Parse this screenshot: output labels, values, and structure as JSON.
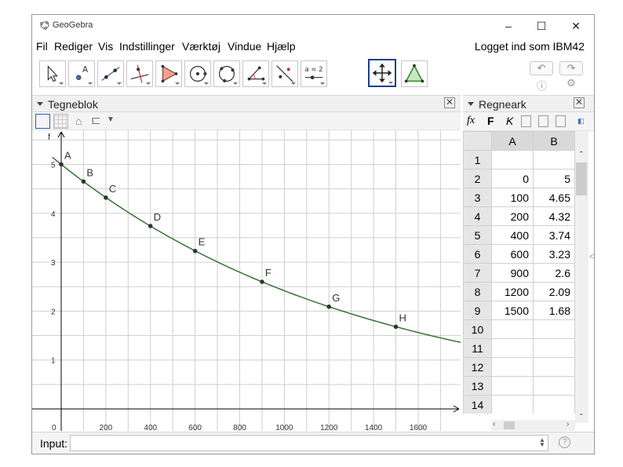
{
  "window": {
    "title": "GeoGebra",
    "controls": {
      "minimize": "–",
      "maximize": "☐",
      "close": "✕"
    }
  },
  "menubar": {
    "items": [
      "Fil",
      "Rediger",
      "Vis",
      "Indstillinger",
      "Værktøj",
      "Vindue",
      "Hjælp"
    ],
    "login": "Logget ind som IBM42"
  },
  "toolbar": {
    "tools": [
      {
        "icon": "move-arrow-icon",
        "active": false
      },
      {
        "icon": "point-icon",
        "active": false,
        "label": "A"
      },
      {
        "icon": "line-icon",
        "active": false
      },
      {
        "icon": "perpendicular-line-icon",
        "active": false
      },
      {
        "icon": "polygon-icon",
        "active": false
      },
      {
        "icon": "circle-center-point-icon",
        "active": false
      },
      {
        "icon": "circle-three-points-icon",
        "active": false
      },
      {
        "icon": "angle-icon",
        "active": false
      },
      {
        "icon": "reflect-icon",
        "active": false
      },
      {
        "icon": "slider-icon",
        "active": false,
        "label": "a = 2"
      },
      {
        "icon": "move-graphics-view-icon",
        "active": true
      },
      {
        "icon": "triangle-icon",
        "active": false
      }
    ],
    "undo": "↶",
    "redo": "↷"
  },
  "graphics": {
    "panel_title": "Tegneblok",
    "function_label": "f",
    "x_ticks": [
      {
        "value": 0,
        "label": "0"
      },
      {
        "value": 200,
        "label": "200"
      },
      {
        "value": 400,
        "label": "400"
      },
      {
        "value": 600,
        "label": "600"
      },
      {
        "value": 800,
        "label": "800"
      },
      {
        "value": 1000,
        "label": "1000"
      },
      {
        "value": 1200,
        "label": "1200"
      },
      {
        "value": 1400,
        "label": "1400"
      },
      {
        "value": 1600,
        "label": "1600"
      }
    ],
    "y_ticks": [
      {
        "value": 1,
        "label": "1"
      },
      {
        "value": 2,
        "label": "2"
      },
      {
        "value": 3,
        "label": "3"
      },
      {
        "value": 4,
        "label": "4"
      },
      {
        "value": 5,
        "label": "5"
      }
    ],
    "points": [
      {
        "name": "A",
        "x": 0,
        "y": 5
      },
      {
        "name": "B",
        "x": 100,
        "y": 4.65
      },
      {
        "name": "C",
        "x": 200,
        "y": 4.32
      },
      {
        "name": "D",
        "x": 400,
        "y": 3.74
      },
      {
        "name": "E",
        "x": 600,
        "y": 3.23
      },
      {
        "name": "F",
        "x": 900,
        "y": 2.6
      },
      {
        "name": "G",
        "x": 1200,
        "y": 2.09
      },
      {
        "name": "H",
        "x": 1500,
        "y": 1.68
      }
    ],
    "curve": {
      "a": 5,
      "k": 0.000727,
      "color": "#2a6b2a"
    },
    "axis_range": {
      "x": [
        -20,
        1790
      ],
      "y": [
        -0.1,
        5.3
      ]
    }
  },
  "spreadsheet": {
    "panel_title": "Regneark",
    "format_buttons": {
      "fx": "fx",
      "bold": "F",
      "italic": "K"
    },
    "columns": [
      "A",
      "B"
    ],
    "rows": [
      {
        "n": "1",
        "a": "",
        "b": ""
      },
      {
        "n": "2",
        "a": "0",
        "b": "5"
      },
      {
        "n": "3",
        "a": "100",
        "b": "4.65"
      },
      {
        "n": "4",
        "a": "200",
        "b": "4.32"
      },
      {
        "n": "5",
        "a": "400",
        "b": "3.74"
      },
      {
        "n": "6",
        "a": "600",
        "b": "3.23"
      },
      {
        "n": "7",
        "a": "900",
        "b": "2.6"
      },
      {
        "n": "8",
        "a": "1200",
        "b": "2.09"
      },
      {
        "n": "9",
        "a": "1500",
        "b": "1.68"
      },
      {
        "n": "10",
        "a": "",
        "b": ""
      },
      {
        "n": "11",
        "a": "",
        "b": ""
      },
      {
        "n": "12",
        "a": "",
        "b": ""
      },
      {
        "n": "13",
        "a": "",
        "b": ""
      },
      {
        "n": "14",
        "a": "",
        "b": ""
      }
    ]
  },
  "input_bar": {
    "label": "Input:",
    "value": "",
    "help": "?"
  },
  "colors": {
    "grid": "#cfcfcf",
    "axis": "#000000",
    "point": "#333333",
    "active_tool": "#1b3f8f"
  }
}
